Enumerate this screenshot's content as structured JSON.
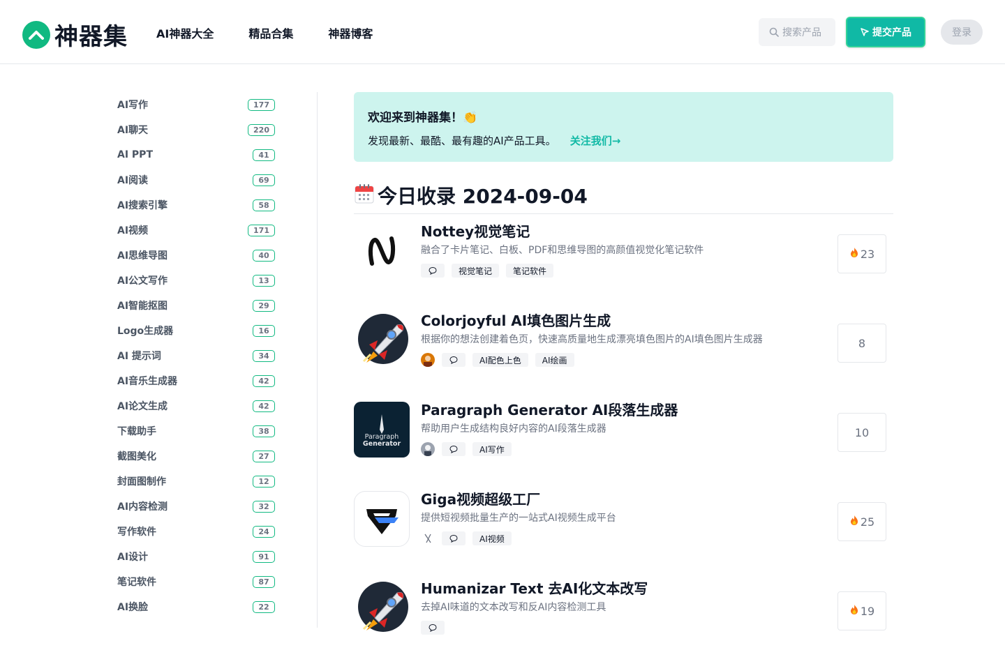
{
  "header": {
    "logo_text": "神器集",
    "nav": [
      "AI神器大全",
      "精品合集",
      "神器博客"
    ],
    "search_placeholder": "搜索产品",
    "submit_label": "提交产品",
    "login_label": "登录",
    "accent_color": "#10b9a5"
  },
  "sidebar": {
    "categories": [
      {
        "label": "AI写作",
        "count": "177"
      },
      {
        "label": "AI聊天",
        "count": "220"
      },
      {
        "label": "AI PPT",
        "count": "41"
      },
      {
        "label": "AI阅读",
        "count": "69"
      },
      {
        "label": "AI搜索引擎",
        "count": "58"
      },
      {
        "label": "AI视频",
        "count": "171"
      },
      {
        "label": "AI思维导图",
        "count": "40"
      },
      {
        "label": "AI公文写作",
        "count": "13"
      },
      {
        "label": "AI智能抠图",
        "count": "29"
      },
      {
        "label": "Logo生成器",
        "count": "16"
      },
      {
        "label": "AI 提示词",
        "count": "34"
      },
      {
        "label": "AI音乐生成器",
        "count": "42"
      },
      {
        "label": "AI论文生成",
        "count": "42"
      },
      {
        "label": "下载助手",
        "count": "38"
      },
      {
        "label": "截图美化",
        "count": "27"
      },
      {
        "label": "封面图制作",
        "count": "12"
      },
      {
        "label": "AI内容检测",
        "count": "32"
      },
      {
        "label": "写作软件",
        "count": "24"
      },
      {
        "label": "AI设计",
        "count": "91"
      },
      {
        "label": "笔记软件",
        "count": "87"
      },
      {
        "label": "AI换脸",
        "count": "22"
      }
    ]
  },
  "banner": {
    "title": "欢迎来到神器集！👏",
    "subtitle": "发现最新、最酷、最有趣的AI产品工具。",
    "link": "关注我们→"
  },
  "day": {
    "icon": "calendar-icon",
    "title": "今日收录 2024-09-04"
  },
  "items": [
    {
      "title": "Nottey视觉笔记",
      "desc": "融合了卡片笔记、白板、PDF和思维导图的高颜值视觉化笔记软件",
      "tags": [
        "视觉笔记",
        "笔记软件"
      ],
      "votes": "23",
      "hot": true,
      "thumb": "nottey-logo"
    },
    {
      "title": "Colorjoyful AI填色图片生成",
      "desc": "根据你的想法创建着色页，快速高质量地生成漂亮填色图片的AI填色图片生成器",
      "tags": [
        "AI配色上色",
        "AI绘画"
      ],
      "votes": "8",
      "hot": false,
      "thumb": "rocket-logo"
    },
    {
      "title": "Paragraph Generator AI段落生成器",
      "desc": "帮助用户生成结构良好内容的AI段落生成器",
      "tags": [
        "AI写作"
      ],
      "votes": "10",
      "hot": false,
      "thumb": "paragraph-logo",
      "thumb_text": [
        "Paragraph",
        "Generator"
      ]
    },
    {
      "title": "Giga视频超级工厂",
      "desc": "提供短视频批量生产的一站式AI视频生成平台",
      "tags": [
        "AI视频"
      ],
      "votes": "25",
      "hot": true,
      "thumb": "giga-logo"
    },
    {
      "title": "Humanizar Text 去AI化文本改写",
      "desc": "去掉AI味道的文本改写和反AI内容检测工具",
      "tags": [],
      "votes": "19",
      "hot": true,
      "thumb": "rocket-logo"
    }
  ]
}
